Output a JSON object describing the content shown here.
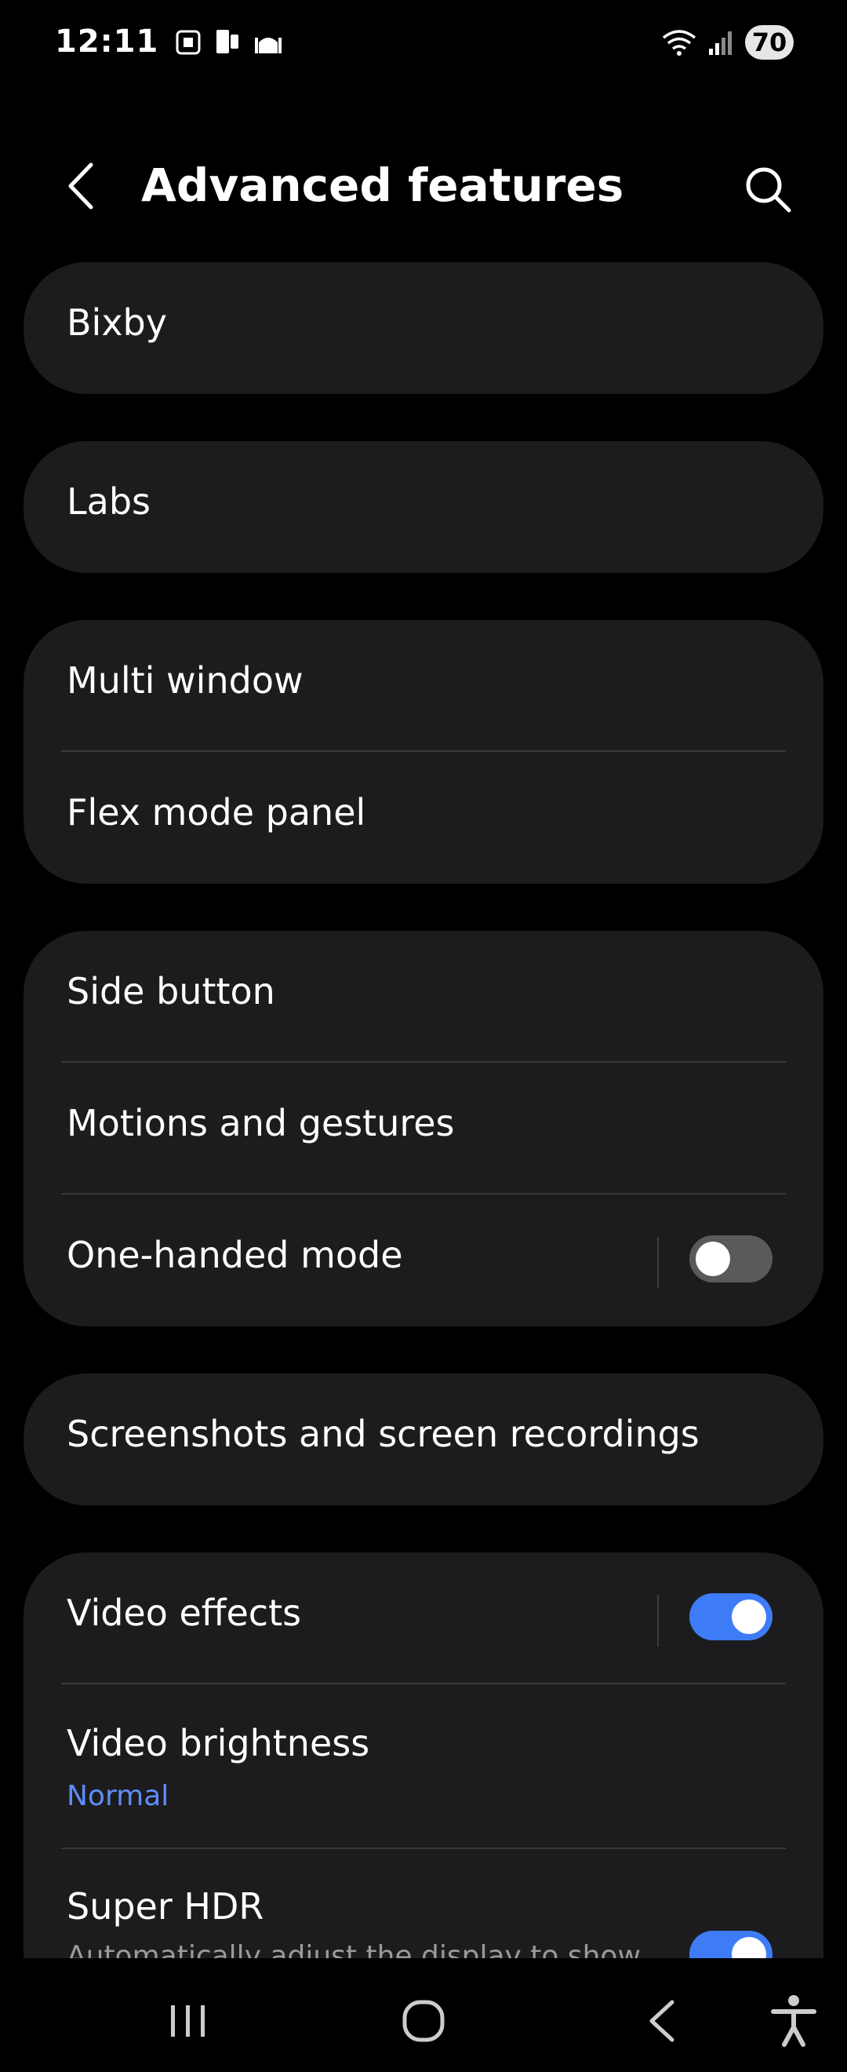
{
  "status_bar": {
    "time": "12:11",
    "battery": "70"
  },
  "header": {
    "title": "Advanced features"
  },
  "groups": [
    {
      "items": [
        {
          "label": "Bixby"
        }
      ]
    },
    {
      "items": [
        {
          "label": "Labs"
        }
      ]
    },
    {
      "items": [
        {
          "label": "Multi window"
        },
        {
          "label": "Flex mode panel"
        }
      ]
    },
    {
      "items": [
        {
          "label": "Side button"
        },
        {
          "label": "Motions and gestures"
        },
        {
          "label": "One-handed mode",
          "toggle": "off"
        }
      ]
    },
    {
      "items": [
        {
          "label": "Screenshots and screen recordings"
        }
      ]
    },
    {
      "items": [
        {
          "label": "Video effects",
          "toggle": "on"
        },
        {
          "label": "Video brightness",
          "value": "Normal"
        },
        {
          "label": "Super HDR",
          "description": "Automatically adjust the display to show",
          "toggle": "on"
        }
      ]
    }
  ],
  "colors": {
    "background": "#000000",
    "card": "#1c1c1e",
    "accent": "#3e7bf6",
    "link": "#5e8df7"
  },
  "icons": {
    "back": "chevron-left-icon",
    "search": "search-icon",
    "recents": "recents-icon",
    "home": "home-icon",
    "nav_back": "back-icon",
    "accessibility": "accessibility-icon"
  }
}
